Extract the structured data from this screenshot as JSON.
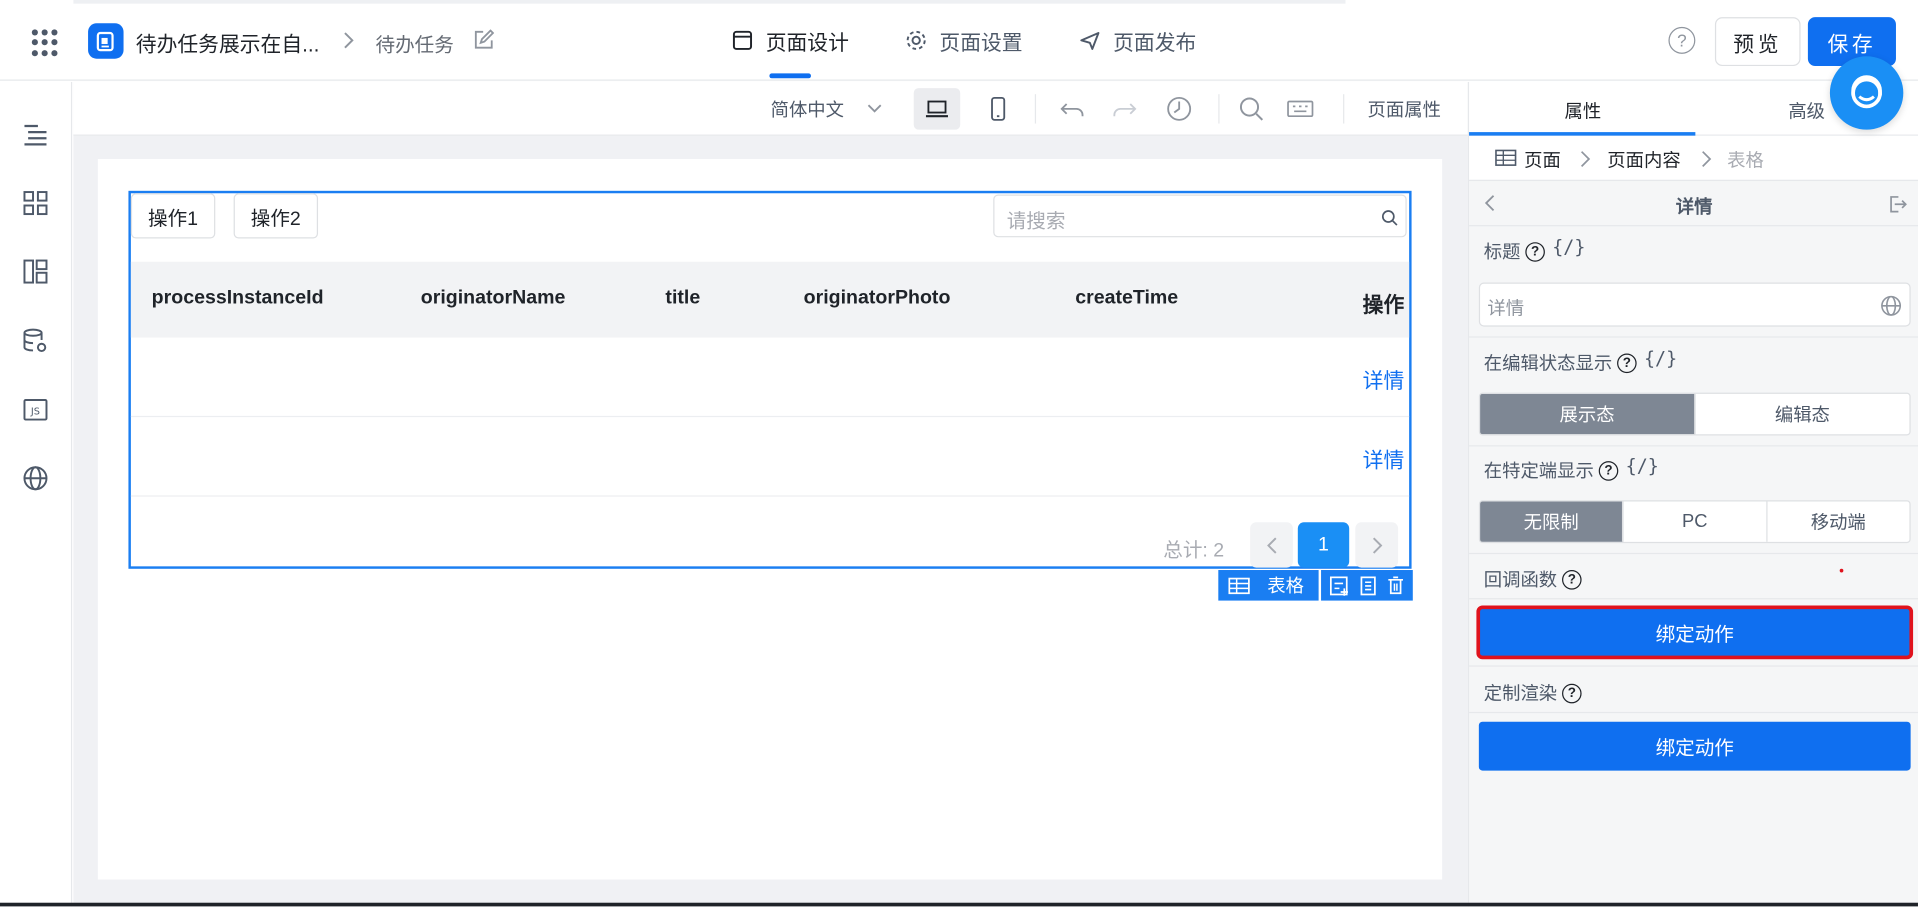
{
  "header": {
    "app_title": "待办任务展示在自...",
    "page_name": "待办任务",
    "nav": [
      {
        "label": "页面设计",
        "icon": "page-layout-icon"
      },
      {
        "label": "页面设置",
        "icon": "gear-icon"
      },
      {
        "label": "页面发布",
        "icon": "send-icon"
      }
    ],
    "help_glyph": "?",
    "preview_label": "预览",
    "save_label": "保存"
  },
  "toolbar": {
    "language": "简体中文",
    "page_attr_label": "页面属性"
  },
  "table": {
    "actions": [
      "操作1",
      "操作2"
    ],
    "search_placeholder": "请搜索",
    "columns": [
      "processInstanceId",
      "originatorName",
      "title",
      "originatorPhoto",
      "createTime",
      "操作"
    ],
    "rows": [
      {
        "action": "详情"
      },
      {
        "action": "详情"
      }
    ],
    "total_label": "总计: 2",
    "current_page": "1",
    "component_tag": "表格"
  },
  "panel": {
    "tabs": [
      "属性",
      "高级"
    ],
    "breadcrumb": [
      "页面",
      "页面内容",
      "表格"
    ],
    "subtitle": "详情",
    "title_label": "标题",
    "title_value": "详情",
    "expr_glyph": "{/}",
    "q_glyph": "?",
    "edit_state_label": "在编辑状态显示",
    "edit_state_options": [
      "展示态",
      "编辑态"
    ],
    "terminal_label": "在特定端显示",
    "terminal_options": [
      "无限制",
      "PC",
      "移动端"
    ],
    "callback_label": "回调函数",
    "callback_button": "绑定动作",
    "custom_render_label": "定制渲染",
    "custom_render_button": "绑定动作"
  },
  "colors": {
    "primary": "#0f6ff0",
    "selection_border": "#1a7ef2",
    "highlight_outline": "#e0131d"
  }
}
